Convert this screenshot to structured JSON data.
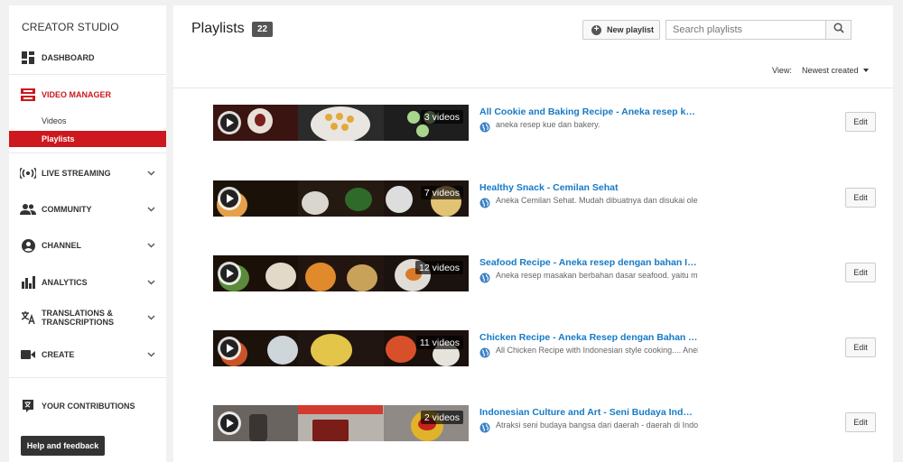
{
  "sidebar": {
    "studio_title": "CREATOR STUDIO",
    "nav": [
      {
        "label": "DASHBOARD",
        "icon": "dashboard-icon"
      },
      {
        "label": "VIDEO MANAGER",
        "icon": "video-manager-icon",
        "active": true
      },
      {
        "label": "LIVE STREAMING",
        "icon": "live-streaming-icon"
      },
      {
        "label": "COMMUNITY",
        "icon": "community-icon"
      },
      {
        "label": "CHANNEL",
        "icon": "channel-icon"
      },
      {
        "label": "ANALYTICS",
        "icon": "analytics-icon"
      },
      {
        "label": "TRANSLATIONS &\nTRANSCRIPTIONS",
        "icon": "translate-icon"
      },
      {
        "label": "CREATE",
        "icon": "create-icon"
      },
      {
        "label": "YOUR CONTRIBUTIONS",
        "icon": "contributions-icon"
      }
    ],
    "sub_items": [
      {
        "label": "Videos"
      },
      {
        "label": "Playlists",
        "selected": true
      }
    ],
    "help_label": "Help and feedback",
    "accent_color": "#cc181e"
  },
  "main": {
    "title": "Playlists",
    "count": "22",
    "new_playlist_label": "New playlist",
    "search_placeholder": "Search playlists",
    "view_label": "View:",
    "sort_value": "Newest created",
    "edit_label": "Edit",
    "link_color": "#167ac6"
  },
  "playlists": [
    {
      "title": "All Cookie and Baking Recipe - Aneka resep kue d...",
      "description": "aneka resep kue dan bakery.",
      "video_count": "3 videos"
    },
    {
      "title": "Healthy Snack - Cemilan Sehat",
      "description": "Aneka Cemilan Sehat. Mudah dibuatnya dan disukai oleh",
      "video_count": "7 videos"
    },
    {
      "title": "Seafood Recipe - Aneka resep dengan bahan Ikan ...",
      "description": "Aneka resep masakan berbahan dasar seafood. yaitu mu",
      "video_count": "12 videos"
    },
    {
      "title": "Chicken Recipe - Aneka Resep dengan Bahan Ayam",
      "description": "All Chicken Recipe with Indonesian style cooking.... Aneka",
      "video_count": "11 videos"
    },
    {
      "title": "Indonesian Culture and Art - Seni Budaya Indonesia",
      "description": "Atraksi seni budaya bangsa dari daerah - daerah di Indon",
      "video_count": "2 videos"
    }
  ]
}
